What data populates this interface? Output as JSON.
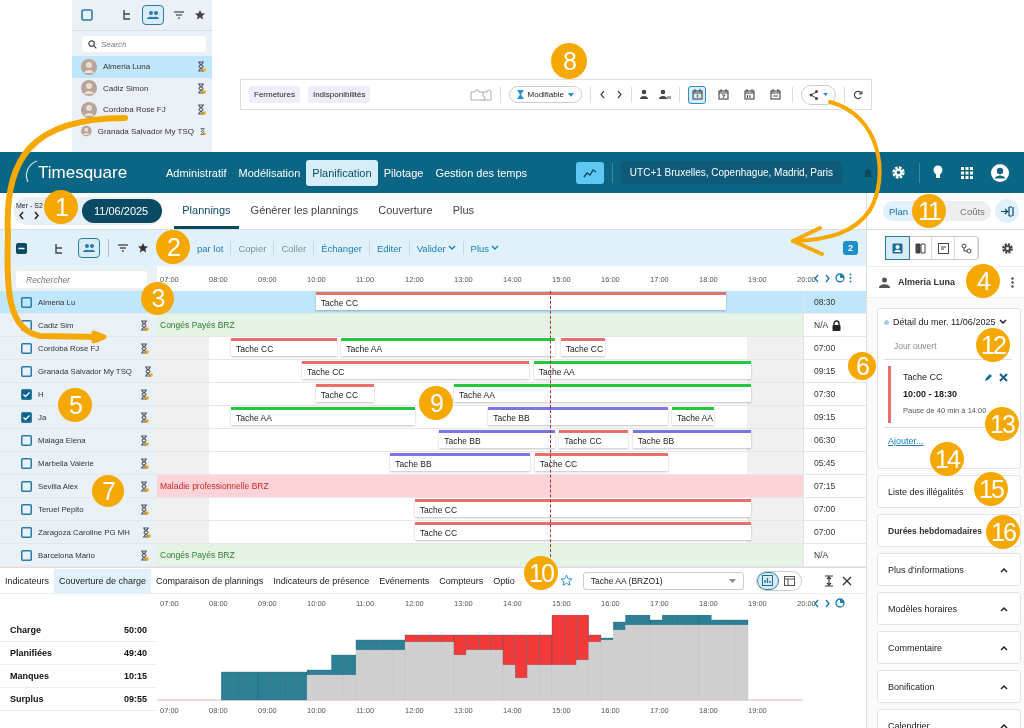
{
  "inset_resource_panel": {
    "select_all": {
      "checked": false
    },
    "search": {
      "placeholder": "Search"
    },
    "people": [
      {
        "name": "Almeria Luna",
        "selected": true
      },
      {
        "name": "Cadiz Simon",
        "selected": false
      },
      {
        "name": "Cordoba Rose FJ",
        "selected": false
      },
      {
        "name": "Granada Salvador My TSQ",
        "selected": false
      }
    ]
  },
  "inset_toolbar": {
    "chips": [
      "Fermetures",
      "Indisponibilités"
    ],
    "status_dropdown": {
      "value": "Modifiable"
    },
    "views": [
      {
        "kind": "day",
        "selected": true
      },
      {
        "kind": "week",
        "selected": false
      },
      {
        "kind": "month",
        "selected": false
      },
      {
        "kind": "range",
        "selected": false
      }
    ]
  },
  "header": {
    "logo": "Timesquare",
    "nav": [
      {
        "label": "Administratif",
        "selected": false
      },
      {
        "label": "Modélisation",
        "selected": false
      },
      {
        "label": "Planification",
        "selected": true
      },
      {
        "label": "Pilotage",
        "selected": false
      },
      {
        "label": "Gestion des temps",
        "selected": false
      }
    ],
    "timezone": "UTC+1 Bruxelles, Copenhague, Madrid, Paris"
  },
  "subbar": {
    "week": "Mer - S2",
    "date": "11/06/2025",
    "tabs": [
      {
        "label": "Plannings",
        "selected": true
      },
      {
        "label": "Générer les plannings",
        "selected": false
      },
      {
        "label": "Couverture",
        "selected": false
      },
      {
        "label": "Plus",
        "selected": false
      }
    ]
  },
  "toolbar": {
    "select_all": {
      "indeterminate": true
    },
    "grouping": [
      {
        "kind": "tree",
        "selected": false
      },
      {
        "kind": "group",
        "selected": true
      }
    ],
    "actions": [
      {
        "label": "par lot",
        "disabled": false,
        "kind": "plain"
      },
      {
        "label": "Copier",
        "disabled": true,
        "kind": "plain"
      },
      {
        "label": "Coller",
        "disabled": true,
        "kind": "plain"
      },
      {
        "label": "Échanger",
        "disabled": false,
        "kind": "plain"
      },
      {
        "label": "Editer",
        "disabled": false,
        "kind": "plain"
      },
      {
        "label": "Valider",
        "disabled": false,
        "kind": "menu"
      },
      {
        "label": "Plus",
        "disabled": false,
        "kind": "menu"
      }
    ],
    "badge": "2"
  },
  "grid": {
    "search": {
      "placeholder": "Rechercher"
    },
    "hours": [
      "07:00",
      "08:00",
      "09:00",
      "10:00",
      "11:00",
      "12:00",
      "13:00",
      "14:00",
      "15:00",
      "16:00",
      "17:00",
      "18:00",
      "19:00",
      "20:00"
    ],
    "rows": [
      {
        "name": "Almeria Lu",
        "checked": false,
        "selected": true,
        "kind": "tasks",
        "total": "08:30",
        "locked": false,
        "tasks": [
          {
            "label": "Tache CC",
            "color": "#e8706a"
          }
        ]
      },
      {
        "name": "Cadiz Sim",
        "checked": false,
        "selected": false,
        "kind": "absence",
        "total": "N/A",
        "locked": true,
        "absence": {
          "label": "Congés Payés BRZ",
          "color": "#e4f3e4"
        }
      },
      {
        "name": "Cordoba Rose FJ",
        "checked": false,
        "selected": false,
        "kind": "tasks",
        "total": "07:00",
        "locked": false,
        "tasks": [
          {
            "label": "Tache CC",
            "color": "#e8706a"
          },
          {
            "label": "Tache AA",
            "color": "#22c93c"
          },
          {
            "label": "Tache CC",
            "color": "#e8706a"
          }
        ]
      },
      {
        "name": "Granada Salvador My TSQ",
        "checked": false,
        "selected": false,
        "kind": "tasks",
        "total": "09:15",
        "locked": false,
        "tasks": [
          {
            "label": "Tache CC",
            "color": "#e8706a"
          },
          {
            "label": "Tache AA",
            "color": "#22c93c"
          }
        ]
      },
      {
        "name": "H",
        "checked": true,
        "selected": false,
        "kind": "tasks",
        "total": "07:30",
        "locked": false,
        "tasks": [
          {
            "label": "Tache CC",
            "color": "#e8706a"
          },
          {
            "label": "Tache AA",
            "color": "#22c93c"
          }
        ]
      },
      {
        "name": "Ja",
        "checked": true,
        "selected": false,
        "kind": "tasks",
        "total": "09:15",
        "locked": false,
        "tasks": [
          {
            "label": "Tache AA",
            "color": "#22c93c"
          },
          {
            "label": "Tache BB",
            "color": "#7b74e6"
          },
          {
            "label": "Tache AA",
            "color": "#22c93c"
          }
        ]
      },
      {
        "name": "Malaga Elena",
        "checked": false,
        "selected": false,
        "kind": "tasks",
        "total": "06:30",
        "locked": false,
        "tasks": [
          {
            "label": "Tache BB",
            "color": "#7b74e6"
          },
          {
            "label": "Tache CC",
            "color": "#e8706a"
          },
          {
            "label": "Tache BB",
            "color": "#7b74e6"
          }
        ]
      },
      {
        "name": "Marbella Valérie",
        "checked": false,
        "selected": false,
        "kind": "tasks",
        "total": "05:45",
        "locked": false,
        "tasks": [
          {
            "label": "Tache BB",
            "color": "#7b74e6"
          },
          {
            "label": "Tache CC",
            "color": "#e8706a"
          }
        ]
      },
      {
        "name": "Sevilla Alex",
        "checked": false,
        "selected": false,
        "kind": "absence",
        "total": "07:15",
        "locked": false,
        "absence": {
          "label": "Maladie professionnelle BRZ",
          "color": "#fdd3d8"
        }
      },
      {
        "name": "Teruel Pepito",
        "checked": false,
        "selected": false,
        "kind": "tasks",
        "total": "07:00",
        "locked": false,
        "tasks": [
          {
            "label": "Tache CC",
            "color": "#e8706a"
          }
        ]
      },
      {
        "name": "Zaragoza Caroline PG MH",
        "checked": false,
        "selected": false,
        "kind": "tasks",
        "total": "07:00",
        "locked": false,
        "tasks": [
          {
            "label": "Tache CC",
            "color": "#e8706a"
          }
        ]
      },
      {
        "name": "Barcelona Mario",
        "checked": false,
        "selected": false,
        "kind": "absence",
        "total": "N/A",
        "locked": false,
        "absence": {
          "label": "Congés Payés BRZ",
          "color": "#e4f3e4"
        }
      }
    ]
  },
  "bottom_panel": {
    "tabs": [
      {
        "label": "Indicateurs",
        "selected": false
      },
      {
        "label": "Couverture de charge",
        "selected": true
      },
      {
        "label": "Comparaison de plannings",
        "selected": false
      },
      {
        "label": "Indicateurs de présence",
        "selected": false
      },
      {
        "label": "Evénements",
        "selected": false
      },
      {
        "label": "Compteurs",
        "selected": false
      },
      {
        "label": "Optio",
        "selected": false
      }
    ],
    "task_select": {
      "value": "Tache AA (BRZO1)"
    },
    "view_toggle": [
      {
        "kind": "chart",
        "selected": true
      },
      {
        "kind": "table",
        "selected": false
      }
    ],
    "hours": [
      "07:00",
      "08:00",
      "09:00",
      "10:00",
      "11:00",
      "12:00",
      "13:00",
      "14:00",
      "15:00",
      "16:00",
      "17:00",
      "18:00",
      "19:00",
      "20:00"
    ],
    "indicators": [
      {
        "label": "Charge",
        "value": "50:00"
      },
      {
        "label": "Planifiées",
        "value": "49:40"
      },
      {
        "label": "Manques",
        "value": "10:15"
      },
      {
        "label": "Surplus",
        "value": "09:55"
      }
    ],
    "axis_labels": [
      "07:00",
      "08:00",
      "09:00",
      "10:00",
      "11:00",
      "12:00",
      "13:00",
      "14:00",
      "15:00",
      "16:00",
      "17:00",
      "18:00",
      "19:00"
    ]
  },
  "right_panel": {
    "mode_toggle": [
      {
        "label": "Plan",
        "selected": true
      },
      {
        "label": "Coûts",
        "selected": false
      }
    ],
    "icon_tabs": [
      {
        "kind": "person",
        "selected": true
      },
      {
        "kind": "compare",
        "selected": false
      },
      {
        "kind": "note",
        "selected": false
      },
      {
        "kind": "nodes",
        "selected": false
      }
    ],
    "person": "Almeria Luna",
    "detail": {
      "title": "Détail du mer. 11/06/2025",
      "day_type": "Jour ouvert",
      "task": {
        "label": "Tache CC",
        "time": "10:00 - 18:30",
        "pause": "Pause de 40 min à 14:00"
      },
      "add_link": "Ajouter..."
    },
    "sections": [
      {
        "label": "Liste des illégalités",
        "kind": "link"
      },
      {
        "label": "Durées hebdomadaires",
        "kind": "link"
      },
      {
        "label": "Plus d'informations",
        "kind": "collapsible"
      },
      {
        "label": "Modèles horaires",
        "kind": "collapsible"
      },
      {
        "label": "Commentaire",
        "kind": "collapsible"
      },
      {
        "label": "Bonification",
        "kind": "collapsible"
      },
      {
        "label": "Calendrier",
        "kind": "collapsible"
      }
    ]
  },
  "annotations": [
    {
      "label": "1"
    },
    {
      "label": "2"
    },
    {
      "label": "3"
    },
    {
      "label": "4"
    },
    {
      "label": "5"
    },
    {
      "label": "6"
    },
    {
      "label": "7"
    },
    {
      "label": "8"
    },
    {
      "label": "9"
    },
    {
      "label": "10"
    },
    {
      "label": "11"
    },
    {
      "label": "12"
    },
    {
      "label": "13"
    },
    {
      "label": "14"
    },
    {
      "label": "15"
    },
    {
      "label": "16"
    }
  ]
}
